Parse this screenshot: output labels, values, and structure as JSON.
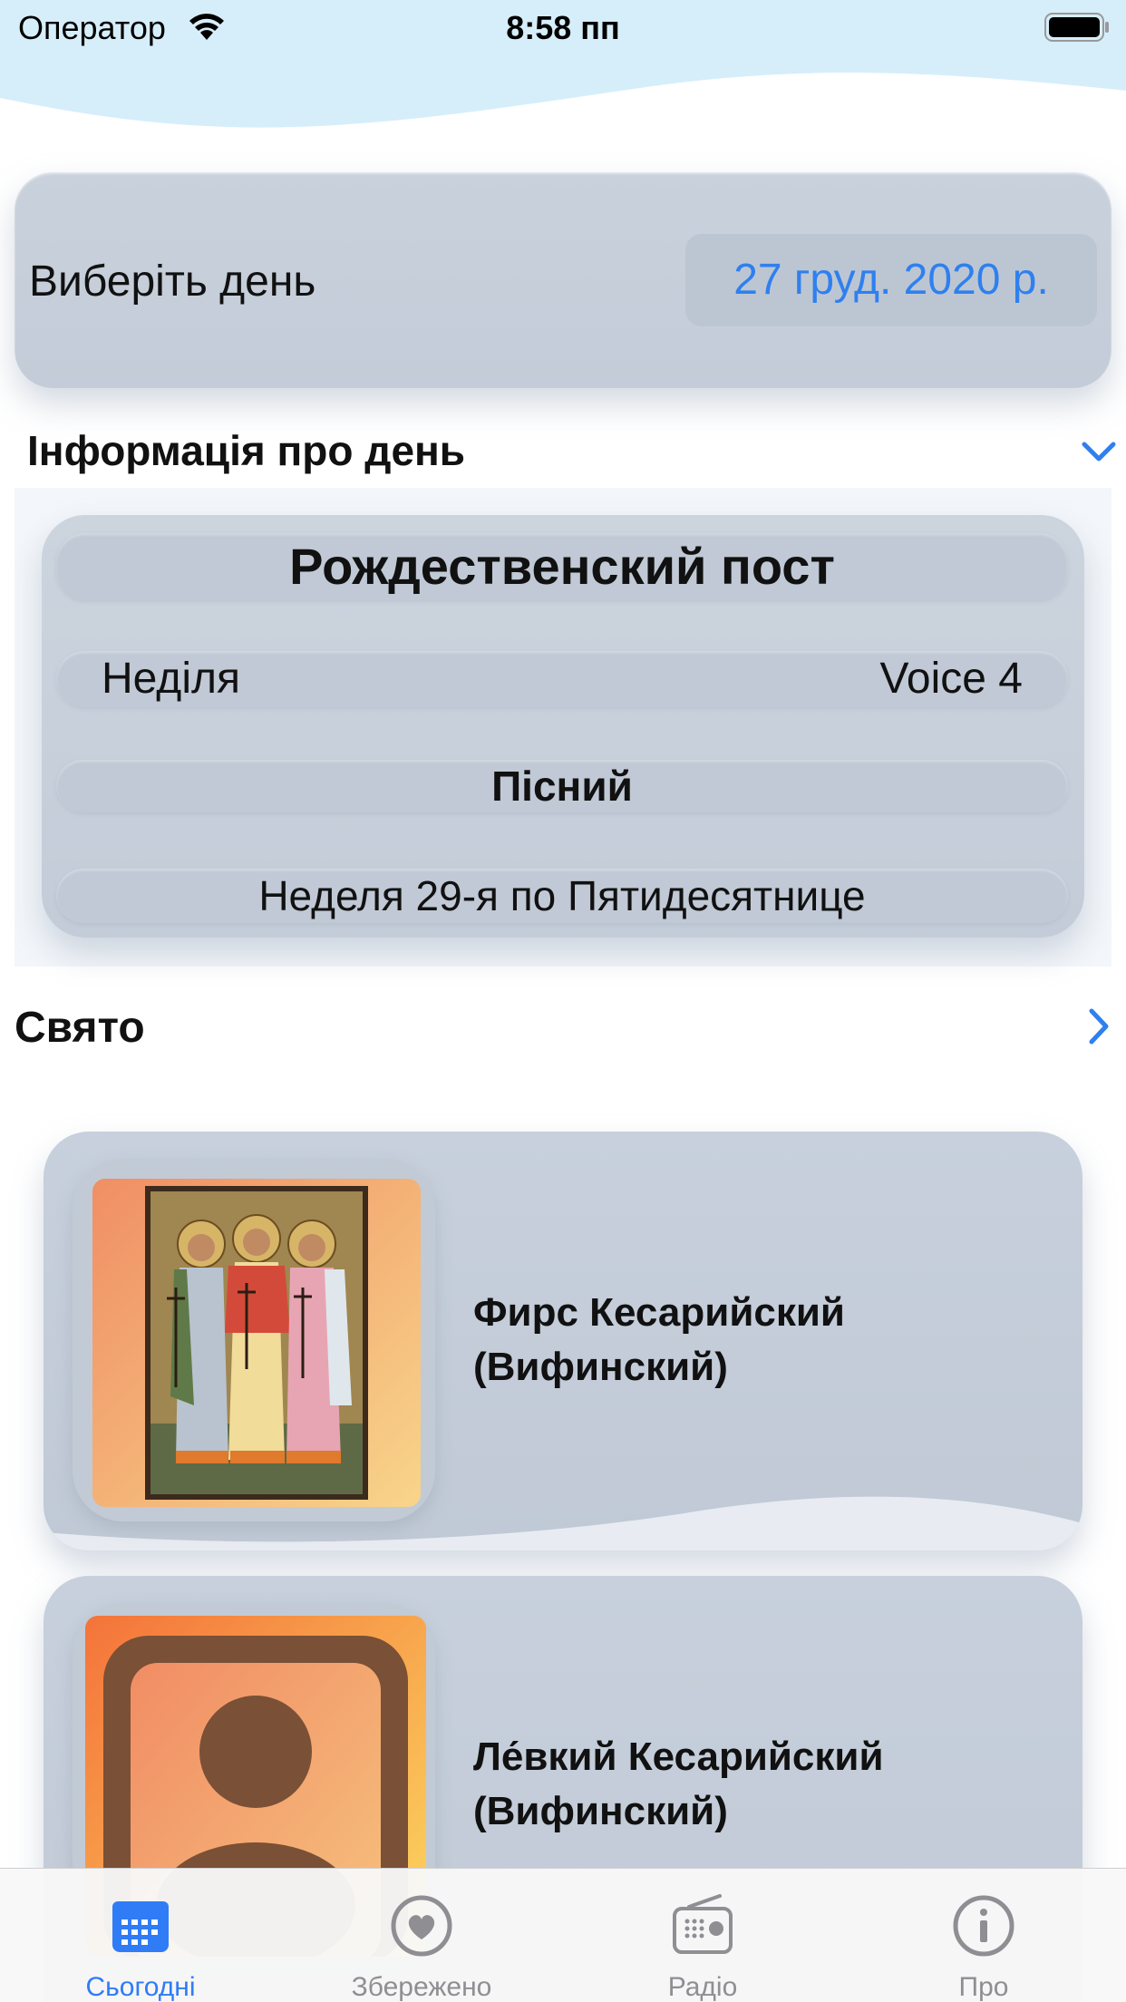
{
  "status_bar": {
    "carrier": "Оператор",
    "time": "8:58 пп"
  },
  "date_picker": {
    "label": "Виберіть день",
    "value": "27 груд. 2020 р."
  },
  "day_info": {
    "section_title": "Інформація про день",
    "fast": "Рождественский пост",
    "weekday": "Неділя",
    "voice": "Voice 4",
    "day_type": "Пісний",
    "week": "Неделя 29-я по Пятидесятнице"
  },
  "feast": {
    "section_title": "Свято",
    "saints": [
      {
        "name": "Фирс Кесарийский (Вифинский)",
        "image": "icon-of-three-saints"
      },
      {
        "name": "Ле́вкий Кесарийский (Вифинский)",
        "image": "person-placeholder-icon"
      }
    ]
  },
  "tab_bar": {
    "tabs": [
      {
        "label": "Сьогодні",
        "icon": "calendar-icon",
        "selected": true
      },
      {
        "label": "Збережено",
        "icon": "heart-icon",
        "selected": false
      },
      {
        "label": "Радіо",
        "icon": "radio-icon",
        "selected": false
      },
      {
        "label": "Про",
        "icon": "info-icon",
        "selected": false
      }
    ]
  },
  "colors": {
    "accent": "#2f80ef",
    "card": "#c5cdd9",
    "header_sky": "#d6eefa"
  }
}
